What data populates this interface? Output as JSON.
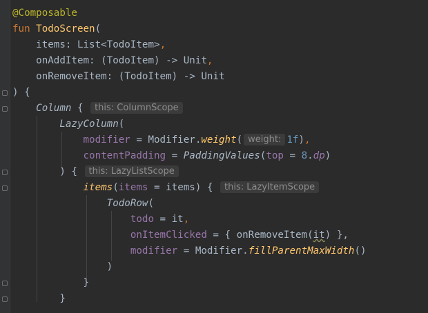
{
  "code": {
    "annotation": "@Composable",
    "fun_kw": "fun",
    "fun_name": "TodoScreen",
    "open_paren": "(",
    "p1_name": "items",
    "p1_rest": ": List<TodoItem>",
    "comma": ",",
    "p2_name": "onAddItem",
    "p2_rest": ": (TodoItem) -> Unit",
    "p3_name": "onRemoveItem",
    "p3_rest": ": (TodoItem) -> Unit",
    "close_brace_open": ") {",
    "column": "Column",
    "brace_open": " {",
    "hint_column": "this: ColumnScope",
    "lazycolumn": "LazyColumn",
    "modifier_param": "modifier",
    "assign": " = ",
    "modifier_obj": "Modifier",
    "dot": ".",
    "weight_fn": "weight",
    "hint_weight": "weight:",
    "weight_val": "1f",
    "close_paren_comma": "),",
    "contentpadding_param": "contentPadding",
    "paddingvalues_fn": "PaddingValues",
    "top_param": "top",
    "top_val": "8",
    "dp": "dp",
    "close_paren": ")",
    "close_brace_lazy": ") {",
    "hint_lazylist": "this: LazyListScope",
    "items_fn": "items",
    "items_param": "items",
    "items_arg": "items",
    "hint_lazyitem": "this: LazyItemScope",
    "todorow": "TodoRow",
    "todo_param": "todo",
    "it": "it",
    "onitemclicked_param": "onItemClicked",
    "lambda_open": "{ onRemoveItem(",
    "lambda_it": "it",
    "lambda_close": ") },",
    "fillparent_fn": "fillParentMaxWidth",
    "empty_parens": "()",
    "rbrace": "}"
  }
}
